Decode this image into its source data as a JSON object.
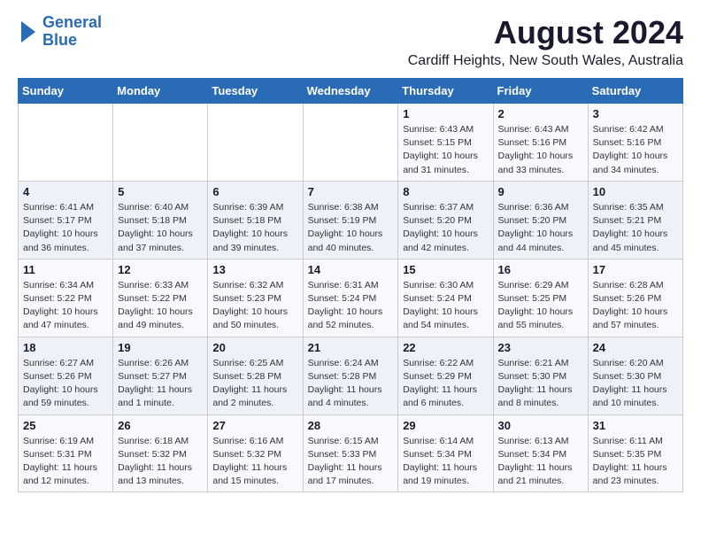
{
  "header": {
    "logo_line1": "General",
    "logo_line2": "Blue",
    "month_year": "August 2024",
    "location": "Cardiff Heights, New South Wales, Australia"
  },
  "weekdays": [
    "Sunday",
    "Monday",
    "Tuesday",
    "Wednesday",
    "Thursday",
    "Friday",
    "Saturday"
  ],
  "weeks": [
    [
      {
        "day": "",
        "detail": ""
      },
      {
        "day": "",
        "detail": ""
      },
      {
        "day": "",
        "detail": ""
      },
      {
        "day": "",
        "detail": ""
      },
      {
        "day": "1",
        "detail": "Sunrise: 6:43 AM\nSunset: 5:15 PM\nDaylight: 10 hours\nand 31 minutes."
      },
      {
        "day": "2",
        "detail": "Sunrise: 6:43 AM\nSunset: 5:16 PM\nDaylight: 10 hours\nand 33 minutes."
      },
      {
        "day": "3",
        "detail": "Sunrise: 6:42 AM\nSunset: 5:16 PM\nDaylight: 10 hours\nand 34 minutes."
      }
    ],
    [
      {
        "day": "4",
        "detail": "Sunrise: 6:41 AM\nSunset: 5:17 PM\nDaylight: 10 hours\nand 36 minutes."
      },
      {
        "day": "5",
        "detail": "Sunrise: 6:40 AM\nSunset: 5:18 PM\nDaylight: 10 hours\nand 37 minutes."
      },
      {
        "day": "6",
        "detail": "Sunrise: 6:39 AM\nSunset: 5:18 PM\nDaylight: 10 hours\nand 39 minutes."
      },
      {
        "day": "7",
        "detail": "Sunrise: 6:38 AM\nSunset: 5:19 PM\nDaylight: 10 hours\nand 40 minutes."
      },
      {
        "day": "8",
        "detail": "Sunrise: 6:37 AM\nSunset: 5:20 PM\nDaylight: 10 hours\nand 42 minutes."
      },
      {
        "day": "9",
        "detail": "Sunrise: 6:36 AM\nSunset: 5:20 PM\nDaylight: 10 hours\nand 44 minutes."
      },
      {
        "day": "10",
        "detail": "Sunrise: 6:35 AM\nSunset: 5:21 PM\nDaylight: 10 hours\nand 45 minutes."
      }
    ],
    [
      {
        "day": "11",
        "detail": "Sunrise: 6:34 AM\nSunset: 5:22 PM\nDaylight: 10 hours\nand 47 minutes."
      },
      {
        "day": "12",
        "detail": "Sunrise: 6:33 AM\nSunset: 5:22 PM\nDaylight: 10 hours\nand 49 minutes."
      },
      {
        "day": "13",
        "detail": "Sunrise: 6:32 AM\nSunset: 5:23 PM\nDaylight: 10 hours\nand 50 minutes."
      },
      {
        "day": "14",
        "detail": "Sunrise: 6:31 AM\nSunset: 5:24 PM\nDaylight: 10 hours\nand 52 minutes."
      },
      {
        "day": "15",
        "detail": "Sunrise: 6:30 AM\nSunset: 5:24 PM\nDaylight: 10 hours\nand 54 minutes."
      },
      {
        "day": "16",
        "detail": "Sunrise: 6:29 AM\nSunset: 5:25 PM\nDaylight: 10 hours\nand 55 minutes."
      },
      {
        "day": "17",
        "detail": "Sunrise: 6:28 AM\nSunset: 5:26 PM\nDaylight: 10 hours\nand 57 minutes."
      }
    ],
    [
      {
        "day": "18",
        "detail": "Sunrise: 6:27 AM\nSunset: 5:26 PM\nDaylight: 10 hours\nand 59 minutes."
      },
      {
        "day": "19",
        "detail": "Sunrise: 6:26 AM\nSunset: 5:27 PM\nDaylight: 11 hours\nand 1 minute."
      },
      {
        "day": "20",
        "detail": "Sunrise: 6:25 AM\nSunset: 5:28 PM\nDaylight: 11 hours\nand 2 minutes."
      },
      {
        "day": "21",
        "detail": "Sunrise: 6:24 AM\nSunset: 5:28 PM\nDaylight: 11 hours\nand 4 minutes."
      },
      {
        "day": "22",
        "detail": "Sunrise: 6:22 AM\nSunset: 5:29 PM\nDaylight: 11 hours\nand 6 minutes."
      },
      {
        "day": "23",
        "detail": "Sunrise: 6:21 AM\nSunset: 5:30 PM\nDaylight: 11 hours\nand 8 minutes."
      },
      {
        "day": "24",
        "detail": "Sunrise: 6:20 AM\nSunset: 5:30 PM\nDaylight: 11 hours\nand 10 minutes."
      }
    ],
    [
      {
        "day": "25",
        "detail": "Sunrise: 6:19 AM\nSunset: 5:31 PM\nDaylight: 11 hours\nand 12 minutes."
      },
      {
        "day": "26",
        "detail": "Sunrise: 6:18 AM\nSunset: 5:32 PM\nDaylight: 11 hours\nand 13 minutes."
      },
      {
        "day": "27",
        "detail": "Sunrise: 6:16 AM\nSunset: 5:32 PM\nDaylight: 11 hours\nand 15 minutes."
      },
      {
        "day": "28",
        "detail": "Sunrise: 6:15 AM\nSunset: 5:33 PM\nDaylight: 11 hours\nand 17 minutes."
      },
      {
        "day": "29",
        "detail": "Sunrise: 6:14 AM\nSunset: 5:34 PM\nDaylight: 11 hours\nand 19 minutes."
      },
      {
        "day": "30",
        "detail": "Sunrise: 6:13 AM\nSunset: 5:34 PM\nDaylight: 11 hours\nand 21 minutes."
      },
      {
        "day": "31",
        "detail": "Sunrise: 6:11 AM\nSunset: 5:35 PM\nDaylight: 11 hours\nand 23 minutes."
      }
    ]
  ]
}
